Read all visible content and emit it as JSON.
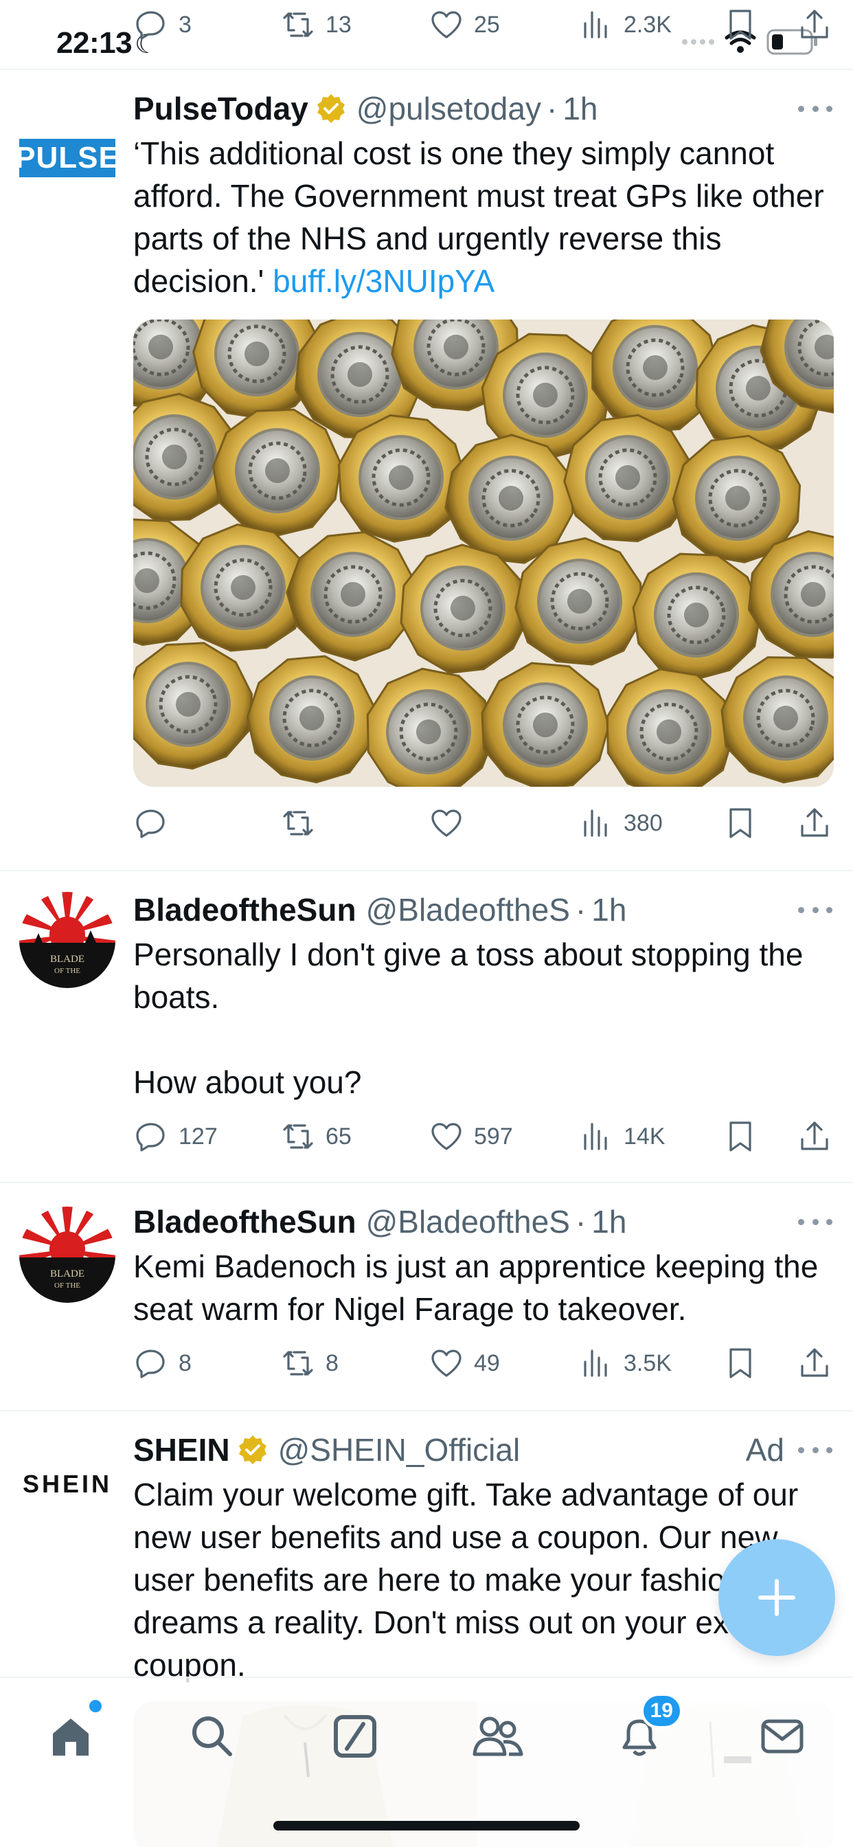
{
  "status_bar": {
    "time": "22:13"
  },
  "top_partial_actions": {
    "replies": "3",
    "reposts": "13",
    "likes": "25",
    "views": "2.3K"
  },
  "tweets": [
    {
      "name": "PulseToday",
      "handle": "@pulsetoday",
      "time": "1h",
      "avatar_text": "PULSE",
      "verified": true,
      "text": "‘This additional cost is one they simply cannot afford. The Government must treat GPs like other parts of the NHS and urgently reverse this decision.' ",
      "link": "buff.ly/3NUIpYA",
      "stats": {
        "replies": "",
        "reposts": "",
        "likes": "",
        "views": "380"
      }
    },
    {
      "name": "BladeoftheSun",
      "handle": "@BladeoftheS",
      "time": "1h",
      "avatar_text": "BLADE OF THE",
      "text_line1": "Personally I don't give a toss about stopping the boats.",
      "text_line2": "How about you?",
      "stats": {
        "replies": "127",
        "reposts": "65",
        "likes": "597",
        "views": "14K"
      }
    },
    {
      "name": "BladeoftheSun",
      "handle": "@BladeoftheS",
      "time": "1h",
      "avatar_text": "BLADE OF THE",
      "text": "Kemi Badenoch is just an apprentice keeping the seat warm for Nigel Farage to takeover.",
      "stats": {
        "replies": "8",
        "reposts": "8",
        "likes": "49",
        "views": "3.5K"
      }
    },
    {
      "name": "SHEIN",
      "handle": "@SHEIN_Official",
      "ad_label": "Ad",
      "avatar_text": "SHEIN",
      "verified": true,
      "text": "Claim your welcome gift. Take advantage of our new user benefits and use a coupon. Our new user benefits are here to make your fashion dreams a reality. Don't miss out on your exclusive coupon."
    }
  ],
  "separator": "·",
  "bottom_nav": {
    "notifications_badge": "19"
  },
  "colors": {
    "accent": "#1d9bf0",
    "verified_gold": "#e2b719",
    "text_secondary": "#536471"
  }
}
